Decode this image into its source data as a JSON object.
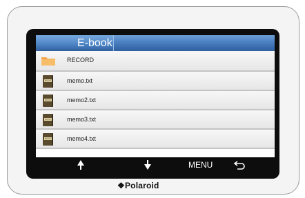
{
  "window": {
    "title": "E-book"
  },
  "files": [
    {
      "name": "RECORD",
      "icon": "folder-icon"
    },
    {
      "name": "memo.txt",
      "icon": "book-icon"
    },
    {
      "name": "memo2.txt",
      "icon": "book-icon"
    },
    {
      "name": "memo3.txt",
      "icon": "book-icon"
    },
    {
      "name": "memo4.txt",
      "icon": "book-icon"
    }
  ],
  "toolbar": {
    "up_icon": "arrow-up-icon",
    "down_icon": "arrow-down-icon",
    "menu_label": "MENU",
    "back_icon": "return-icon"
  },
  "brand": {
    "name": "Polaroid"
  },
  "colors": {
    "titlebar": "#4a7fc0",
    "bezel": "#0d0d0d",
    "row_bg": "#eeeeee"
  }
}
